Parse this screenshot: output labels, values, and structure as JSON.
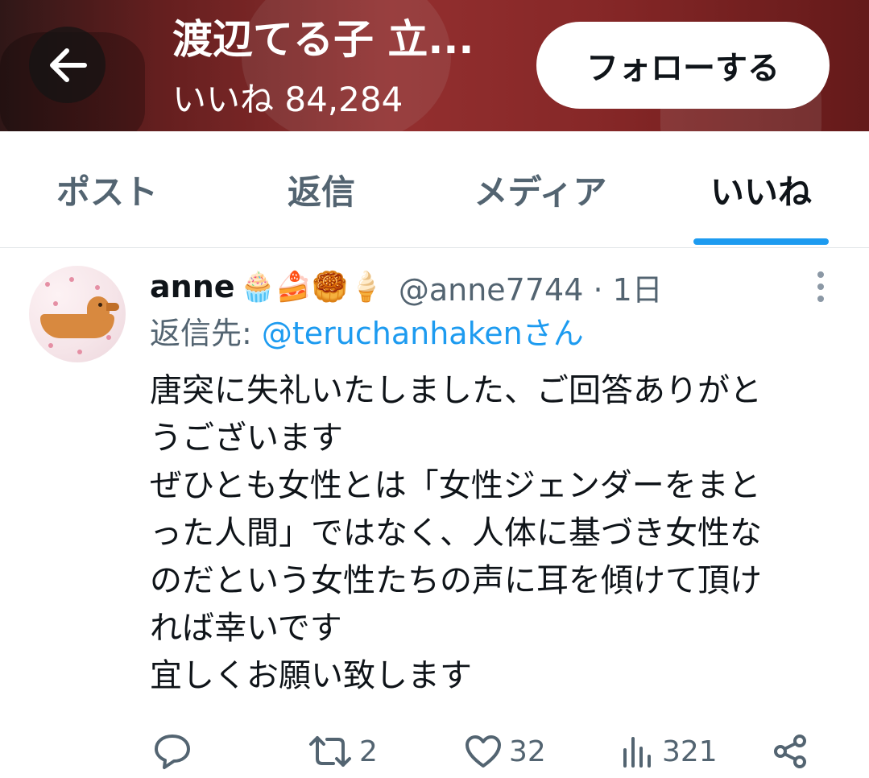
{
  "header": {
    "title": "渡辺てる子 立...",
    "subtitle": "いいね 84,284",
    "follow_label": "フォローする",
    "back_icon": "arrow-left-icon"
  },
  "tabs": [
    {
      "label": "ポスト",
      "active": false
    },
    {
      "label": "返信",
      "active": false
    },
    {
      "label": "メディア",
      "active": false
    },
    {
      "label": "いいね",
      "active": true
    }
  ],
  "post": {
    "username": "anne",
    "emoji": "🧁🍰🥮🍦",
    "handle": "@anne7744 · 1日",
    "reply_prefix": "返信先: ",
    "reply_mention": "@teruchanhakenさん",
    "lines": [
      "唐突に失礼いたしました、ご回答ありがと",
      "うございます",
      "ぜひとも女性とは「女性ジェンダーをまと",
      "った人間」ではなく、人体に基づき女性な",
      "のだという女性たちの声に耳を傾けて頂け",
      "れば幸いです",
      "宜しくお願い致します"
    ],
    "actions": {
      "reply_count": "",
      "repost_count": "2",
      "like_count": "32",
      "views_count": "321"
    }
  },
  "colors": {
    "accent": "#1d9bf0",
    "muted_text": "#536471",
    "primary_text": "#0f1419"
  }
}
